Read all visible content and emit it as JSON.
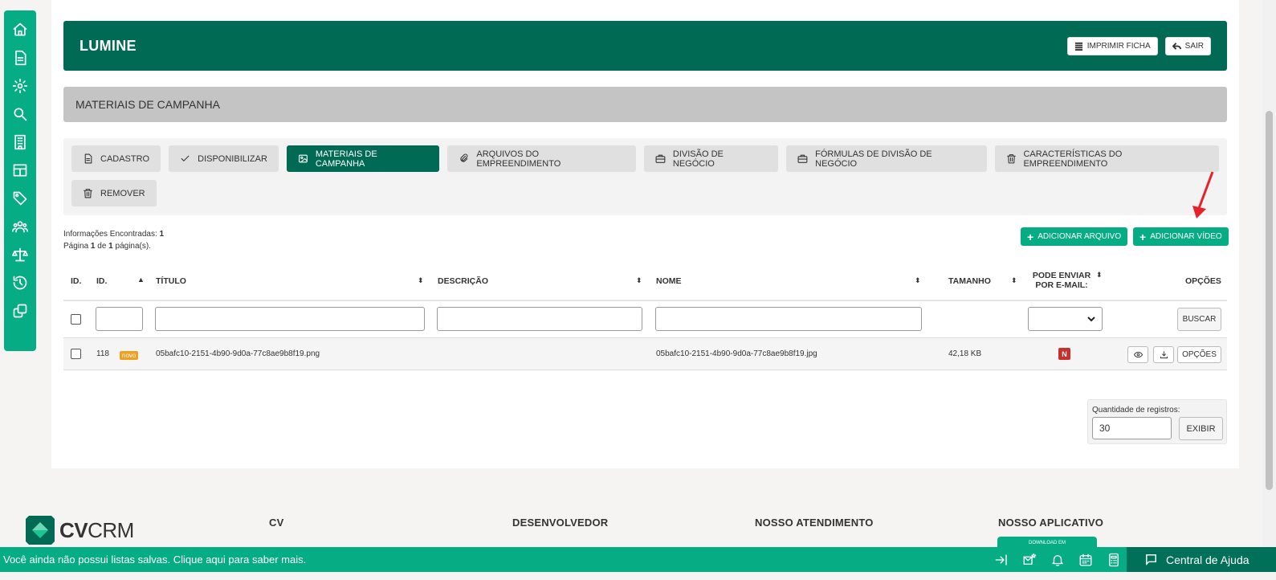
{
  "header": {
    "title": "LUMINE",
    "print_label": "IMPRIMIR FICHA",
    "exit_label": "SAIR"
  },
  "section_title": "MATERIAIS DE CAMPANHA",
  "tabs": [
    {
      "label": "CADASTRO",
      "icon": "document-icon",
      "active": false
    },
    {
      "label": "DISPONIBILIZAR",
      "icon": "check-icon",
      "active": false
    },
    {
      "label": "MATERIAIS DE CAMPANHA",
      "icon": "image-icon",
      "active": true
    },
    {
      "label": "ARQUIVOS DO EMPREENDIMENTO",
      "icon": "paperclip-icon",
      "active": false
    },
    {
      "label": "DIVISÃO DE NEGÓCIO",
      "icon": "briefcase-icon",
      "active": false
    },
    {
      "label": "FÓRMULAS DE DIVISÃO DE NEGÓCIO",
      "icon": "briefcase-icon",
      "active": false
    },
    {
      "label": "CARACTERÍSTICAS DO EMPREENDIMENTO",
      "icon": "trash-icon",
      "active": false
    },
    {
      "label": "REMOVER",
      "icon": "trash-icon",
      "active": false
    }
  ],
  "info": {
    "found_label": "Informações Encontradas:",
    "found_count": "1",
    "page_prefix": "Página",
    "page_current": "1",
    "page_of": "de",
    "page_total": "1",
    "page_suffix": "página(s)."
  },
  "actions": {
    "add_file": "ADICIONAR ARQUIVO",
    "add_video": "ADICIONAR VÍDEO"
  },
  "table": {
    "columns": {
      "id_short": "ID.",
      "id": "ID.",
      "title": "TÍTULO",
      "description": "DESCRIÇÃO",
      "name": "NOME",
      "size": "TAMANHO",
      "can_email_1": "PODE ENVIAR",
      "can_email_2": "POR E-MAIL:",
      "options": "OPÇÕES"
    },
    "search_button": "BUSCAR",
    "rows": [
      {
        "id": "118",
        "badge": "novo",
        "title": "05bafc10-2151-4b90-9d0a-77c8ae9b8f19.png",
        "description": "",
        "name": "05bafc10-2151-4b90-9d0a-77c8ae9b8f19.jpg",
        "size": "42,18 KB",
        "can_email": "N",
        "options_label": "OPÇÕES"
      }
    ]
  },
  "pagination": {
    "qty_label": "Quantidade de registros:",
    "qty_value": "30",
    "show_button": "EXIBIR"
  },
  "footer": {
    "logo_bold": "CV",
    "logo_light": "CRM",
    "col_cv": "CV",
    "col_dev": "DESENVOLVEDOR",
    "col_support": "NOSSO ATENDIMENTO",
    "col_app": "NOSSO APLICATIVO",
    "store_badge": "DOWNLOAD EM"
  },
  "bottom_bar": {
    "message": "Você ainda não possui listas salvas. Clique aqui para saber mais.",
    "help": "Central de Ajuda"
  },
  "colors": {
    "brand_green": "#06ad84",
    "dark_green": "#006a55",
    "badge_orange": "#f0a020",
    "badge_red": "#c9302c"
  }
}
